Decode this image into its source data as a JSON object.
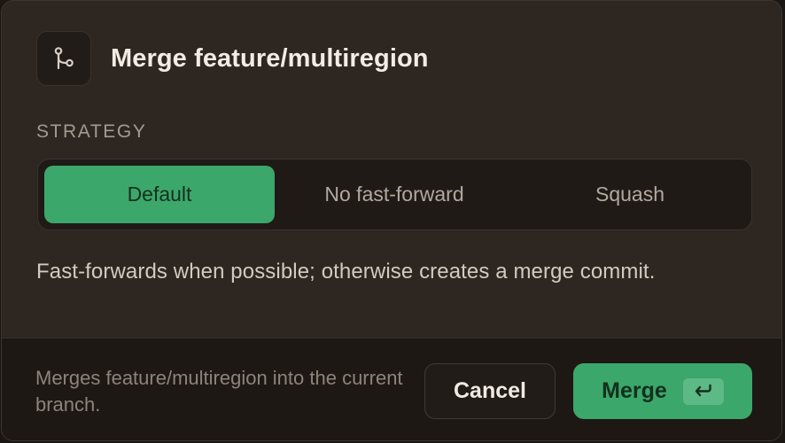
{
  "dialog": {
    "title": "Merge feature/multiregion",
    "title_icon": "git-branch-icon",
    "strategy": {
      "label": "STRATEGY",
      "options": [
        {
          "label": "Default",
          "selected": true
        },
        {
          "label": "No fast-forward",
          "selected": false
        },
        {
          "label": "Squash",
          "selected": false
        }
      ],
      "description": "Fast-forwards when possible; otherwise creates a merge commit."
    },
    "footer": {
      "note": "Merges feature/multiregion into the current branch.",
      "cancel_label": "Cancel",
      "merge_label": "Merge",
      "merge_shortcut_icon": "enter-key-icon"
    }
  },
  "colors": {
    "background": "#2e2620",
    "footer_background": "#1d1814",
    "accent_green": "#3ca76b",
    "text_primary": "#f3ece4",
    "text_muted": "#a49a90"
  }
}
